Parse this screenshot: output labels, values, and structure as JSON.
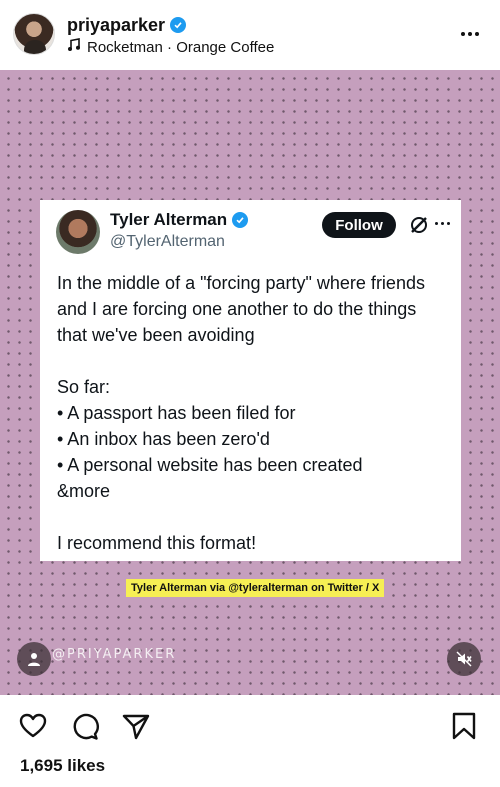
{
  "post": {
    "username": "priyaparker",
    "song": "Rocketman · Orange Coffee"
  },
  "tweet": {
    "name": "Tyler Alterman",
    "handle": "@TylerAlterman",
    "follow_label": "Follow",
    "lines": [
      "In the middle of a \"forcing party\" where friends",
      "and I are forcing one another to do the things",
      "that we've been avoiding",
      "",
      "So far:",
      "• A passport has been filed for",
      "• An inbox has been zero'd",
      "• A personal website has been created",
      "&more",
      "",
      "I recommend this format!"
    ]
  },
  "media": {
    "credit": "Tyler Alterman via @tyleralterman on Twitter / X",
    "watermark": "@PRIYAPARKER",
    "background_color": "#c59fbd"
  },
  "actions": {
    "likes": "1,695 likes"
  },
  "icons": [
    "verified-badge-icon",
    "music-note-icon",
    "more-icon",
    "x-logo-icon",
    "user-tag-icon",
    "mute-icon",
    "heart-icon",
    "comment-icon",
    "share-icon",
    "bookmark-icon"
  ]
}
